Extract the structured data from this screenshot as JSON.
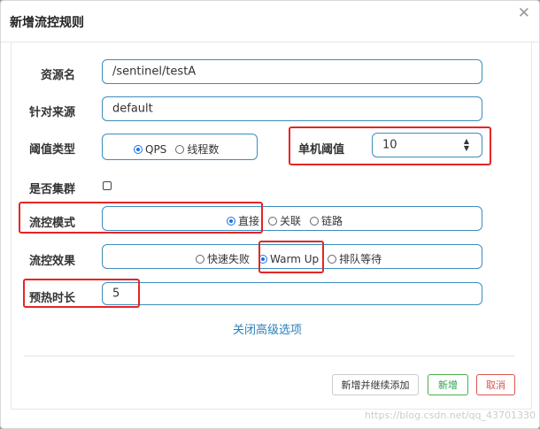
{
  "dialog": {
    "title": "新增流控规则"
  },
  "form": {
    "resource_label": "资源名",
    "resource_value": "/sentinel/testA",
    "source_label": "针对来源",
    "source_value": "default",
    "threshold_type_label": "阈值类型",
    "threshold_type_options": [
      "QPS",
      "线程数"
    ],
    "threshold_type_selected": "QPS",
    "single_threshold_label": "单机阈值",
    "single_threshold_value": "10",
    "cluster_label": "是否集群",
    "cluster_checked": false,
    "mode_label": "流控模式",
    "mode_options": [
      "直接",
      "关联",
      "链路"
    ],
    "mode_selected": "直接",
    "effect_label": "流控效果",
    "effect_options": [
      "快速失败",
      "Warm Up",
      "排队等待"
    ],
    "effect_selected": "Warm Up",
    "warmup_label": "预热时长",
    "warmup_value": "5"
  },
  "advanced_link": "关闭高级选项",
  "buttons": {
    "add_continue": "新增并继续添加",
    "add": "新增",
    "cancel": "取消"
  },
  "colors": {
    "accent": "#3c8dbc",
    "highlight": "#e52525",
    "add": "#2e9e4f",
    "cancel": "#d9534f"
  },
  "watermark": "https://blog.csdn.net/qq_43701330"
}
